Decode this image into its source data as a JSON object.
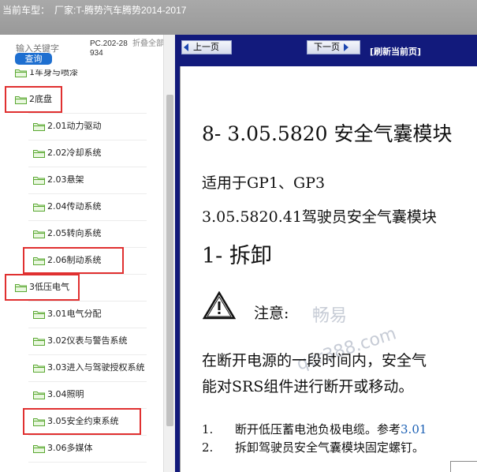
{
  "header": {
    "label": "当前车型：",
    "manufacturer_label": "厂家:",
    "vehicle": "T-腾势汽车腾势2014-2017"
  },
  "search": {
    "placeholder": "输入关键字",
    "button_label": "查询",
    "doc_code": "PC.202-28934",
    "collapse_label": "折叠全部"
  },
  "tree": [
    {
      "label": "1车身与喷漆",
      "level": 0,
      "highlight": false
    },
    {
      "label": "2底盘",
      "level": 0,
      "highlight": true
    },
    {
      "label": "2.01动力驱动",
      "level": 1,
      "highlight": false
    },
    {
      "label": "2.02冷却系统",
      "level": 1,
      "highlight": false
    },
    {
      "label": "2.03悬架",
      "level": 1,
      "highlight": false
    },
    {
      "label": "2.04传动系统",
      "level": 1,
      "highlight": false
    },
    {
      "label": "2.05转向系统",
      "level": 1,
      "highlight": false
    },
    {
      "label": "2.06制动系统",
      "level": 1,
      "highlight": true
    },
    {
      "label": "3低压电气",
      "level": 0,
      "highlight": true
    },
    {
      "label": "3.01电气分配",
      "level": 1,
      "highlight": false
    },
    {
      "label": "3.02仪表与警告系统",
      "level": 1,
      "highlight": false
    },
    {
      "label": "3.03进入与驾驶授权系统",
      "level": 1,
      "highlight": false
    },
    {
      "label": "3.04照明",
      "level": 1,
      "highlight": false
    },
    {
      "label": "3.05安全约束系统",
      "level": 1,
      "highlight": true
    },
    {
      "label": "3.06多媒体",
      "level": 1,
      "highlight": false
    }
  ],
  "nav": {
    "prev_label": "上一页",
    "next_label": "下一页",
    "refresh_label": "[刷新当前页]"
  },
  "doc": {
    "title": "8- 3.05.5820 安全气囊模块",
    "applies": "适用于GP1、GP3",
    "section": "3.05.5820.41驾驶员安全气囊模块",
    "step": "1- 拆卸",
    "note": "注意:",
    "para_line1": "在断开电源的一段时间内，安全气",
    "para_line2": "能对SRS组件进行断开或移动。",
    "steps": [
      {
        "num": "1.",
        "text": "断开低压蓄电池负极电缆。参考",
        "link": "3.01"
      },
      {
        "num": "2.",
        "text": "拆卸驾驶员安全气囊模块固定螺钉。",
        "link": ""
      }
    ]
  },
  "watermark": {
    "line1": "畅易",
    "line2": "qcr388.com"
  },
  "colors": {
    "nav_bg": "#121a7c",
    "search_button": "#1e6fd0",
    "highlight_border": "#e03030",
    "folder_icon": "#5aa832",
    "link": "#1a5fb4"
  }
}
